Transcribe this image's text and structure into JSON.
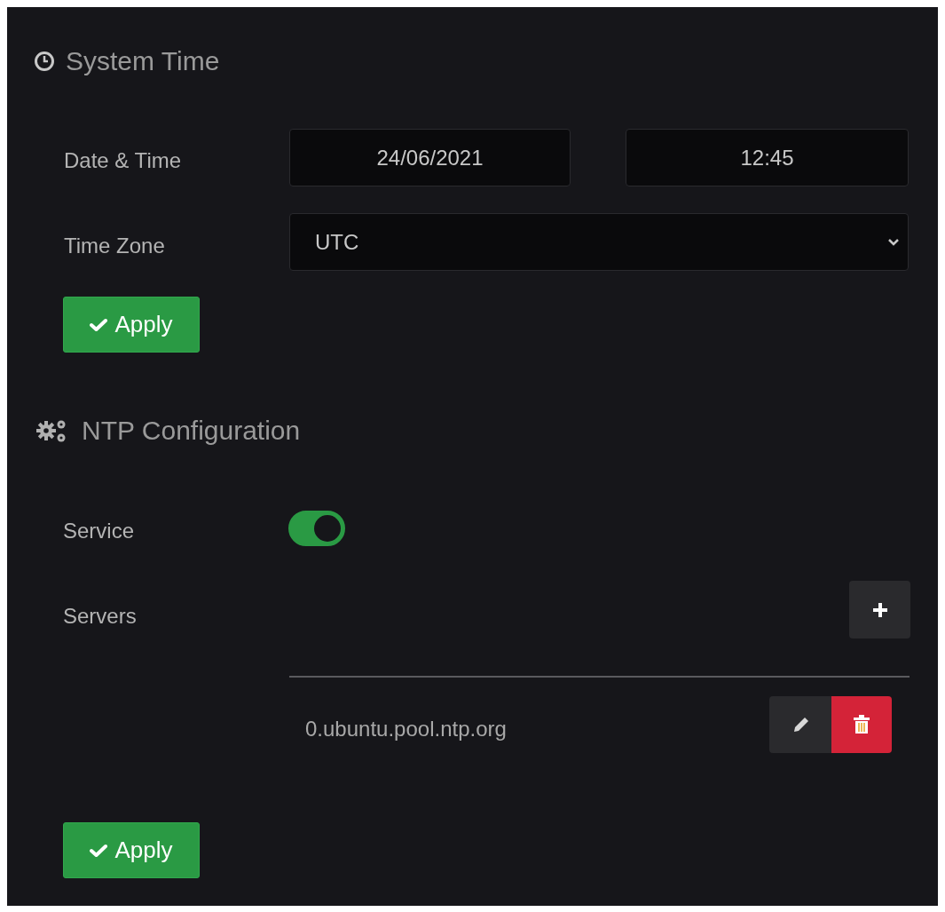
{
  "system_time": {
    "title": "System Time",
    "date_time_label": "Date & Time",
    "date": "24/06/2021",
    "time": "12:45",
    "time_zone_label": "Time Zone",
    "time_zone": "UTC",
    "apply": "Apply"
  },
  "ntp": {
    "title": "NTP Configuration",
    "service_label": "Service",
    "service_on": true,
    "servers_label": "Servers",
    "servers": [
      {
        "address": "0.ubuntu.pool.ntp.org"
      }
    ],
    "apply": "Apply"
  }
}
